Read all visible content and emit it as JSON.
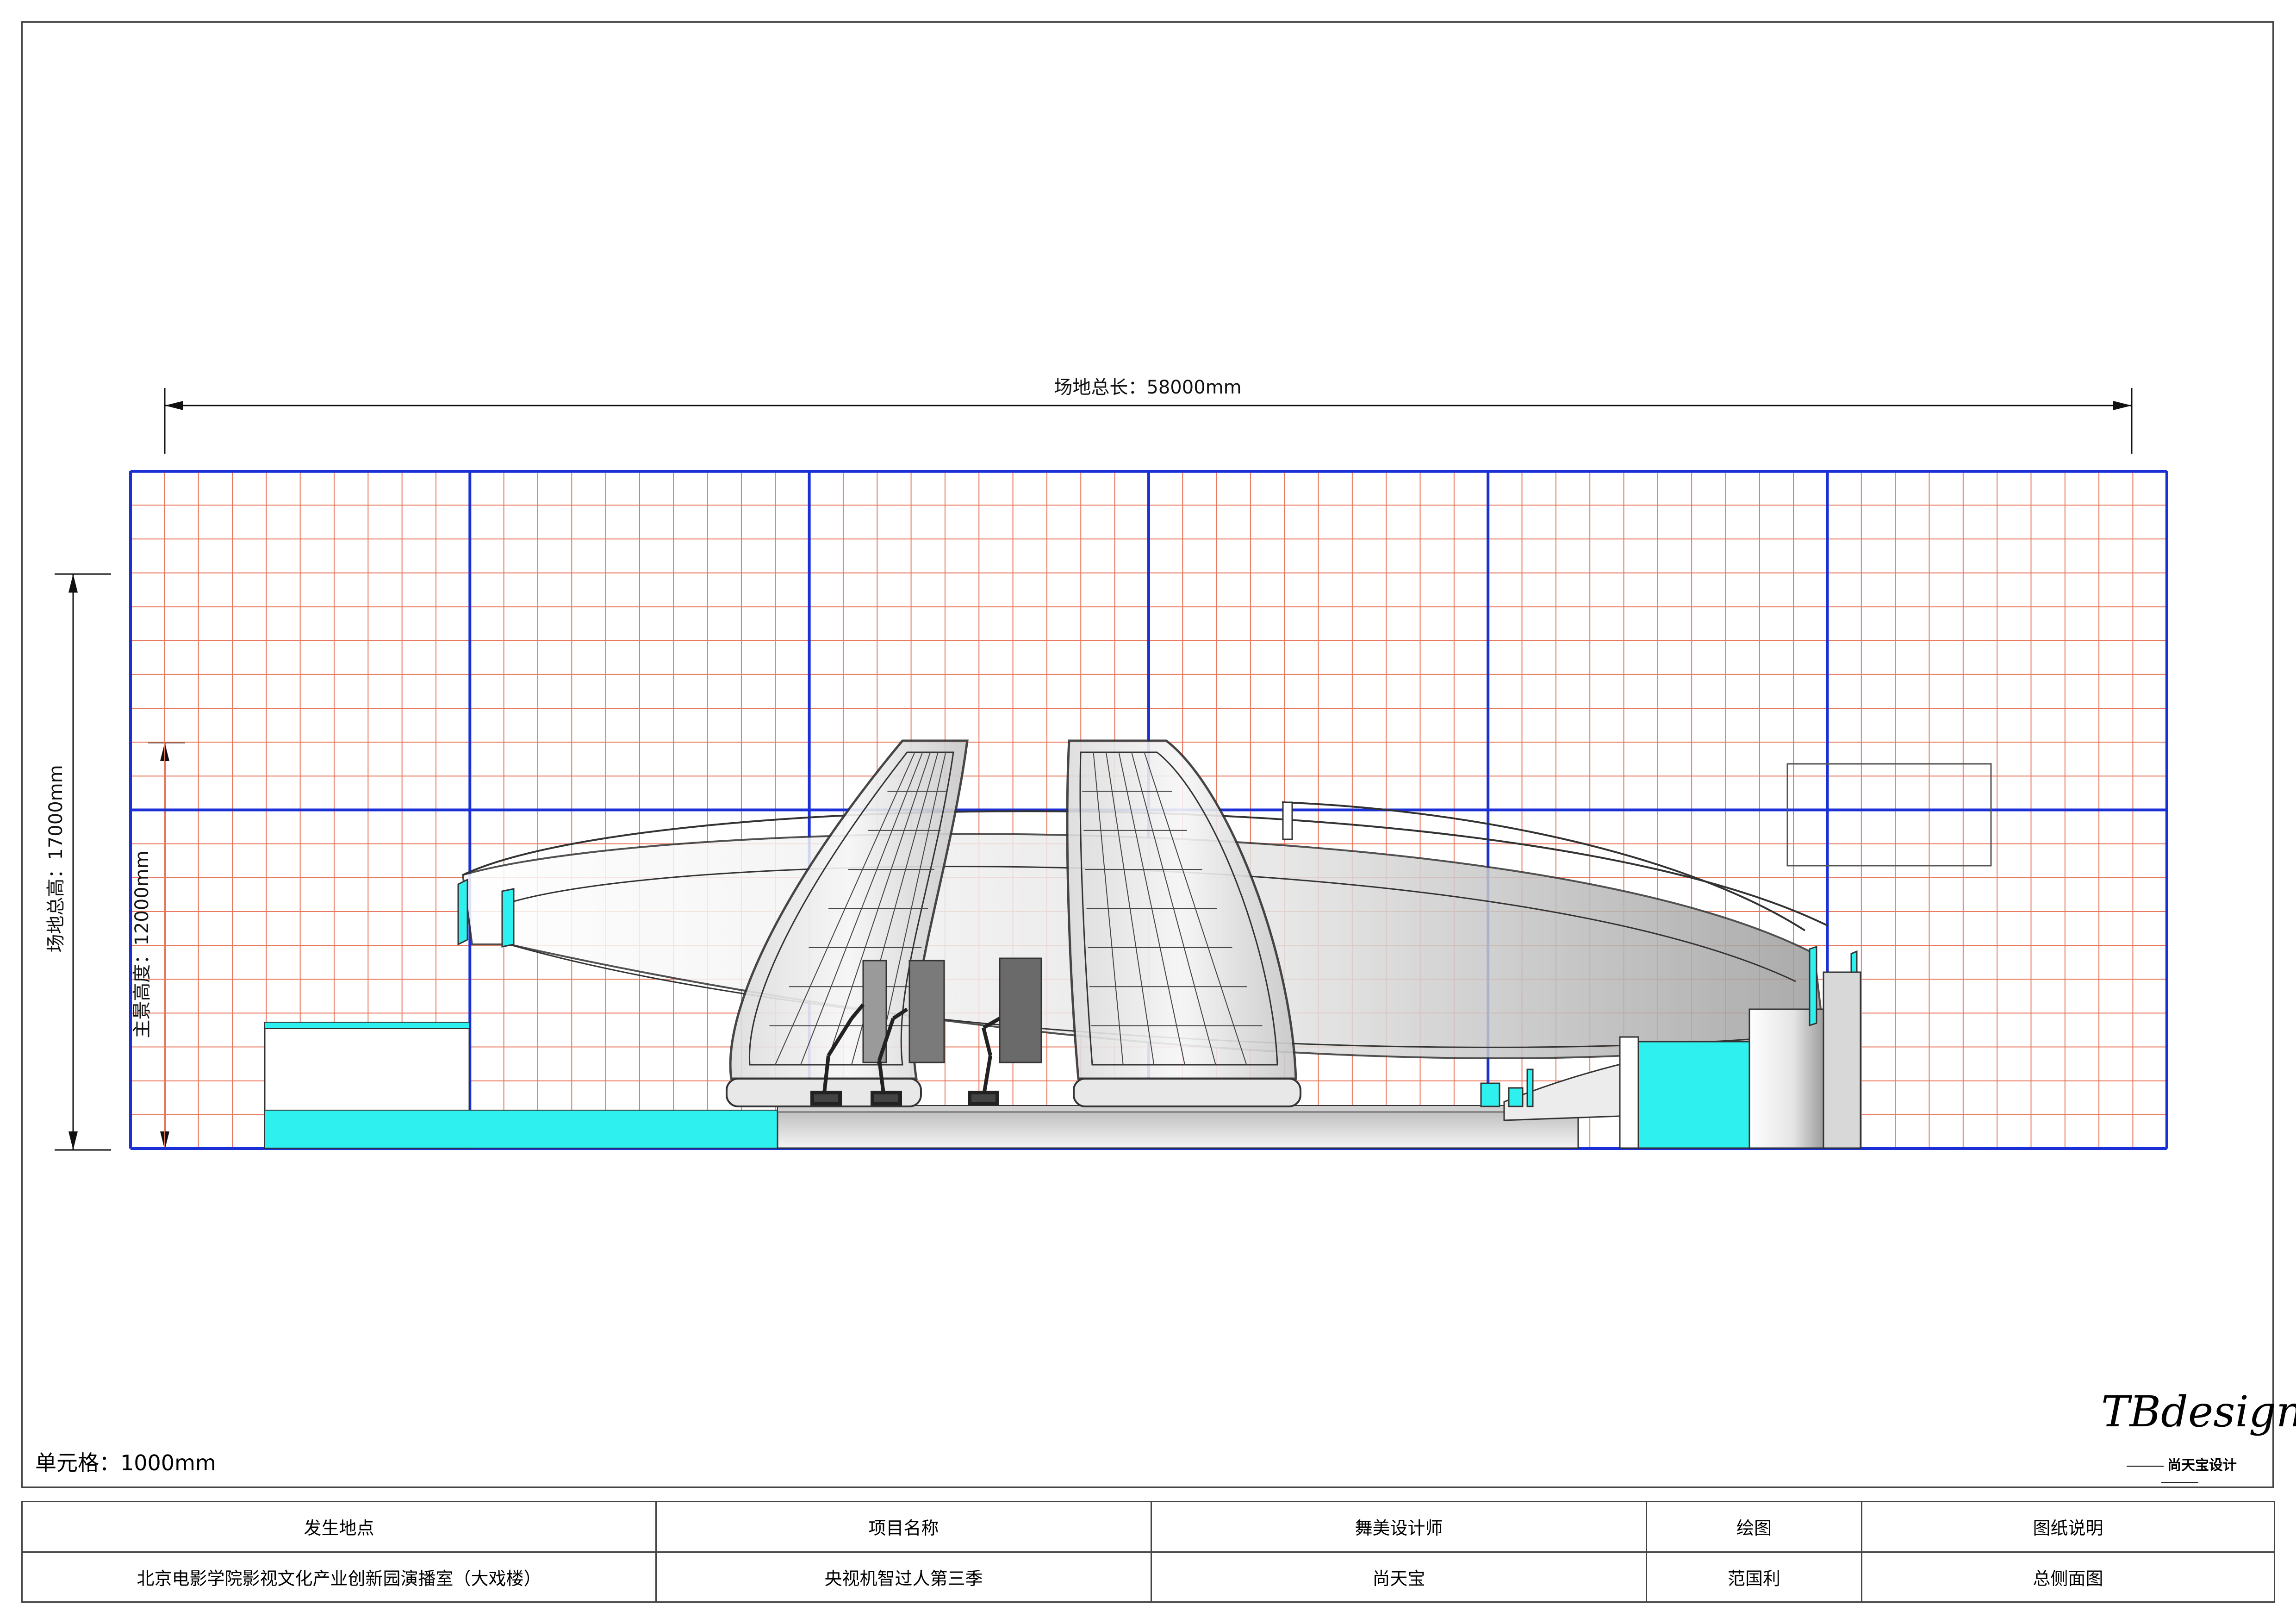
{
  "dimensions": {
    "total_length": "场地总长：58000mm",
    "total_height": "场地总高：17000mm",
    "main_height": "主景高度：12000mm"
  },
  "unit_cell": "单元格：1000mm",
  "logo": {
    "main": "TBdesign",
    "sub": "尚天宝设计"
  },
  "title_block": {
    "headers": [
      "发生地点",
      "项目名称",
      "舞美设计师",
      "绘图",
      "图纸说明"
    ],
    "values": [
      "北京电影学院影视文化产业创新园演播室（大戏楼）",
      "央视机智过人第三季",
      "尚天宝",
      "范国利",
      "总侧面图"
    ]
  },
  "colors": {
    "grid_major": "#1a2fd6",
    "grid_minor": "#e8785f",
    "accent_cyan": "#2ef0ee"
  }
}
